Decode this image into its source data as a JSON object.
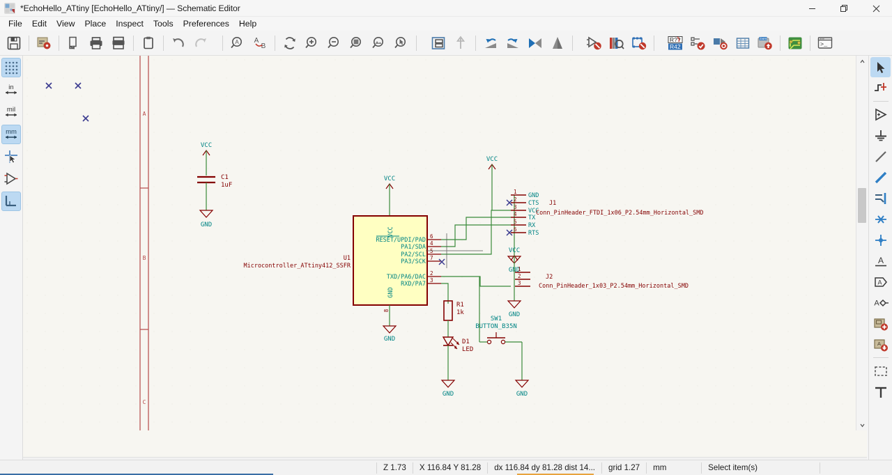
{
  "window": {
    "title": "*EchoHello_ATtiny [EchoHello_ATtiny/] — Schematic Editor",
    "minimize_label": "minimize-icon",
    "maximize_label": "restore-icon",
    "close_label": "close-icon"
  },
  "menubar": {
    "items": [
      {
        "label": "File"
      },
      {
        "label": "Edit"
      },
      {
        "label": "View"
      },
      {
        "label": "Place"
      },
      {
        "label": "Inspect"
      },
      {
        "label": "Tools"
      },
      {
        "label": "Preferences"
      },
      {
        "label": "Help"
      }
    ]
  },
  "toolbar": {
    "items": [
      {
        "name": "save-button",
        "icon": "floppy-save-icon"
      },
      {
        "name": "page-settings-button",
        "icon": "page-settings-icon"
      },
      {
        "name": "print-preview-button",
        "icon": "document-icon"
      },
      {
        "name": "print-button",
        "icon": "printer-icon"
      },
      {
        "name": "plot-button",
        "icon": "plotter-icon"
      },
      {
        "name": "paste-button",
        "icon": "clipboard-paste-icon"
      },
      {
        "name": "undo-button",
        "icon": "undo-arrow-icon"
      },
      {
        "name": "redo-button",
        "icon": "redo-arrow-icon"
      },
      {
        "name": "find-button",
        "icon": "magnifier-a-icon"
      },
      {
        "name": "find-replace-button",
        "icon": "find-replace-ab-icon"
      },
      {
        "name": "refresh-button",
        "icon": "refresh-circular-icon"
      },
      {
        "name": "zoom-in-button",
        "icon": "zoom-in-icon"
      },
      {
        "name": "zoom-out-button",
        "icon": "zoom-out-icon"
      },
      {
        "name": "zoom-fit-page-button",
        "icon": "zoom-fit-page-icon"
      },
      {
        "name": "zoom-fit-objects-button",
        "icon": "zoom-fit-objects-icon"
      },
      {
        "name": "zoom-selection-button",
        "icon": "zoom-selection-icon"
      },
      {
        "name": "show-hierarchy-button",
        "icon": "hierarchy-navigator-icon"
      },
      {
        "name": "leave-sheet-button",
        "icon": "up-arrow-icon"
      },
      {
        "name": "rotate-ccw-button",
        "icon": "rotate-counterclockwise-icon"
      },
      {
        "name": "rotate-cw-button",
        "icon": "rotate-clockwise-icon"
      },
      {
        "name": "mirror-horizontal-button",
        "icon": "mirror-horizontal-icon"
      },
      {
        "name": "mirror-vertical-button",
        "icon": "mirror-vertical-icon"
      },
      {
        "name": "symbol-properties-button",
        "icon": "symbol-no-connect-icon"
      },
      {
        "name": "symbol-library-browser-button",
        "icon": "library-browse-icon"
      },
      {
        "name": "footprint-assign-button",
        "icon": "footprint-assign-icon"
      },
      {
        "name": "annotate-button",
        "icon": "annotate-r42-icon"
      },
      {
        "name": "erc-button",
        "icon": "erc-check-icon"
      },
      {
        "name": "simulator-button",
        "icon": "simulator-icon"
      },
      {
        "name": "symbol-fields-table-button",
        "icon": "fields-table-icon"
      },
      {
        "name": "bom-button",
        "icon": "bom-export-icon"
      },
      {
        "name": "pcb-editor-button",
        "icon": "pcb-board-icon"
      },
      {
        "name": "scripting-console-button",
        "icon": "terminal-console-icon"
      }
    ]
  },
  "left_toolbar": {
    "items": [
      {
        "name": "toggle-grid-button",
        "label": "",
        "icon": "grid-dots-icon",
        "active": true
      },
      {
        "name": "units-inches-button",
        "label": "in",
        "icon": "unit-inches-icon",
        "active": false
      },
      {
        "name": "units-mils-button",
        "label": "mil",
        "icon": "unit-mils-icon",
        "active": false
      },
      {
        "name": "units-mm-button",
        "label": "mm",
        "icon": "unit-mm-icon",
        "active": true
      },
      {
        "name": "toggle-cursor-button",
        "label": "",
        "icon": "full-crosshair-cursor-icon",
        "active": false
      },
      {
        "name": "toggle-invisible-pins-button",
        "label": "",
        "icon": "hidden-pins-icon",
        "active": false
      },
      {
        "name": "toggle-hv-wires-button",
        "label": "",
        "icon": "hv-wire-angle-icon",
        "active": true
      }
    ]
  },
  "right_toolbar": {
    "items": [
      {
        "name": "select-tool",
        "icon": "arrow-pointer-icon",
        "active": true
      },
      {
        "name": "highlight-net-tool",
        "icon": "highlight-net-icon",
        "active": false
      },
      {
        "name": "place-symbol-tool",
        "icon": "add-symbol-icon",
        "active": false
      },
      {
        "name": "place-power-port-tool",
        "icon": "power-port-icon",
        "active": false
      },
      {
        "name": "draw-wire-tool",
        "icon": "draw-wire-icon",
        "active": false
      },
      {
        "name": "draw-bus-tool",
        "icon": "draw-bus-icon",
        "active": false
      },
      {
        "name": "bus-entry-tool",
        "icon": "bus-entry-icon",
        "active": false
      },
      {
        "name": "no-connect-tool",
        "icon": "no-connect-x-icon",
        "active": false
      },
      {
        "name": "junction-tool",
        "icon": "junction-dot-icon",
        "active": false
      },
      {
        "name": "net-label-tool",
        "icon": "net-label-a-icon",
        "active": false
      },
      {
        "name": "global-label-tool",
        "icon": "global-label-icon",
        "active": false
      },
      {
        "name": "hierarchical-label-tool",
        "icon": "hierarchical-label-icon",
        "active": false
      },
      {
        "name": "add-sheet-tool",
        "icon": "add-hierarchical-sheet-icon",
        "active": false
      },
      {
        "name": "import-sheet-pin-tool",
        "icon": "import-sheet-pin-icon",
        "active": false
      },
      {
        "name": "draw-rectangle-tool",
        "icon": "dashed-rectangle-icon",
        "active": false
      },
      {
        "name": "place-text-tool",
        "icon": "text-t-icon",
        "active": false
      }
    ]
  },
  "statusbar": {
    "zoom": "Z 1.73",
    "coords": "X 116.84  Y 81.28",
    "delta": "dx 116.84  dy 81.28  dist 14...",
    "grid": "grid 1.27",
    "units": "mm",
    "mode": "Select item(s)"
  },
  "schematic": {
    "sheet_row_labels": [
      "A",
      "B",
      "C"
    ],
    "components": [
      {
        "ref": "C1",
        "value": "1uF",
        "type": "capacitor",
        "top_power": "VCC",
        "bottom_power": "GND"
      },
      {
        "ref": "U1",
        "value": "Microcontroller_ATtiny412_SSFR",
        "type": "microcontroller",
        "top_pin_label": "VCC",
        "bottom_pin_label": "GND",
        "top_power": "VCC",
        "bottom_power": "GND",
        "pins": [
          {
            "number": "6",
            "name": "RESET/UPDI/PAD",
            "overbar": "RESET"
          },
          {
            "number": "4",
            "name": "PA1/SDA"
          },
          {
            "number": "5",
            "name": "PA2/SCL"
          },
          {
            "number": "7",
            "name": "PA3/SCK",
            "no_connect": true
          },
          {
            "number": "2",
            "name": "TXD/PA6/DAC"
          },
          {
            "number": "3",
            "name": "RXD/PA7"
          }
        ]
      },
      {
        "ref": "J1",
        "value": "Conn_PinHeader_FTDI_1x06_P2.54mm_Horizontal_SMD",
        "type": "connector",
        "top_power": "VCC",
        "bottom_power": "GND",
        "pins": [
          {
            "number": "1",
            "name": "GND"
          },
          {
            "number": "2",
            "name": "CTS",
            "no_connect": true
          },
          {
            "number": "3",
            "name": "VCC"
          },
          {
            "number": "4",
            "name": "TX"
          },
          {
            "number": "5",
            "name": "RX"
          },
          {
            "number": "6",
            "name": "RTS",
            "no_connect": true
          }
        ]
      },
      {
        "ref": "J2",
        "value": "Conn_PinHeader_1x03_P2.54mm_Horizontal_SMD",
        "type": "connector",
        "top_power": "VCC",
        "bottom_power": "GND",
        "pins": [
          {
            "number": "1",
            "name": ""
          },
          {
            "number": "2",
            "name": ""
          },
          {
            "number": "3",
            "name": ""
          }
        ]
      },
      {
        "ref": "R1",
        "value": "1k",
        "type": "resistor"
      },
      {
        "ref": "D1",
        "value": "LED",
        "type": "led",
        "bottom_power": "GND"
      },
      {
        "ref": "SW1",
        "value": "BUTTON_B35N",
        "type": "switch",
        "bottom_power": "GND"
      }
    ],
    "ground_symbols": [
      "GND",
      "GND",
      "GND",
      "GND",
      "GND",
      "GND"
    ],
    "colors": {
      "background": "#f7f6f1",
      "symbol_outline": "#840000",
      "symbol_fill": "#ffffc2",
      "wire": "#008484",
      "wire_green": "#3a8a3a",
      "label_text": "#008484",
      "pin_number": "#840000",
      "pin_name": "#008484",
      "no_connect": "#0000c8",
      "sheet_border": "#b5494a"
    }
  }
}
